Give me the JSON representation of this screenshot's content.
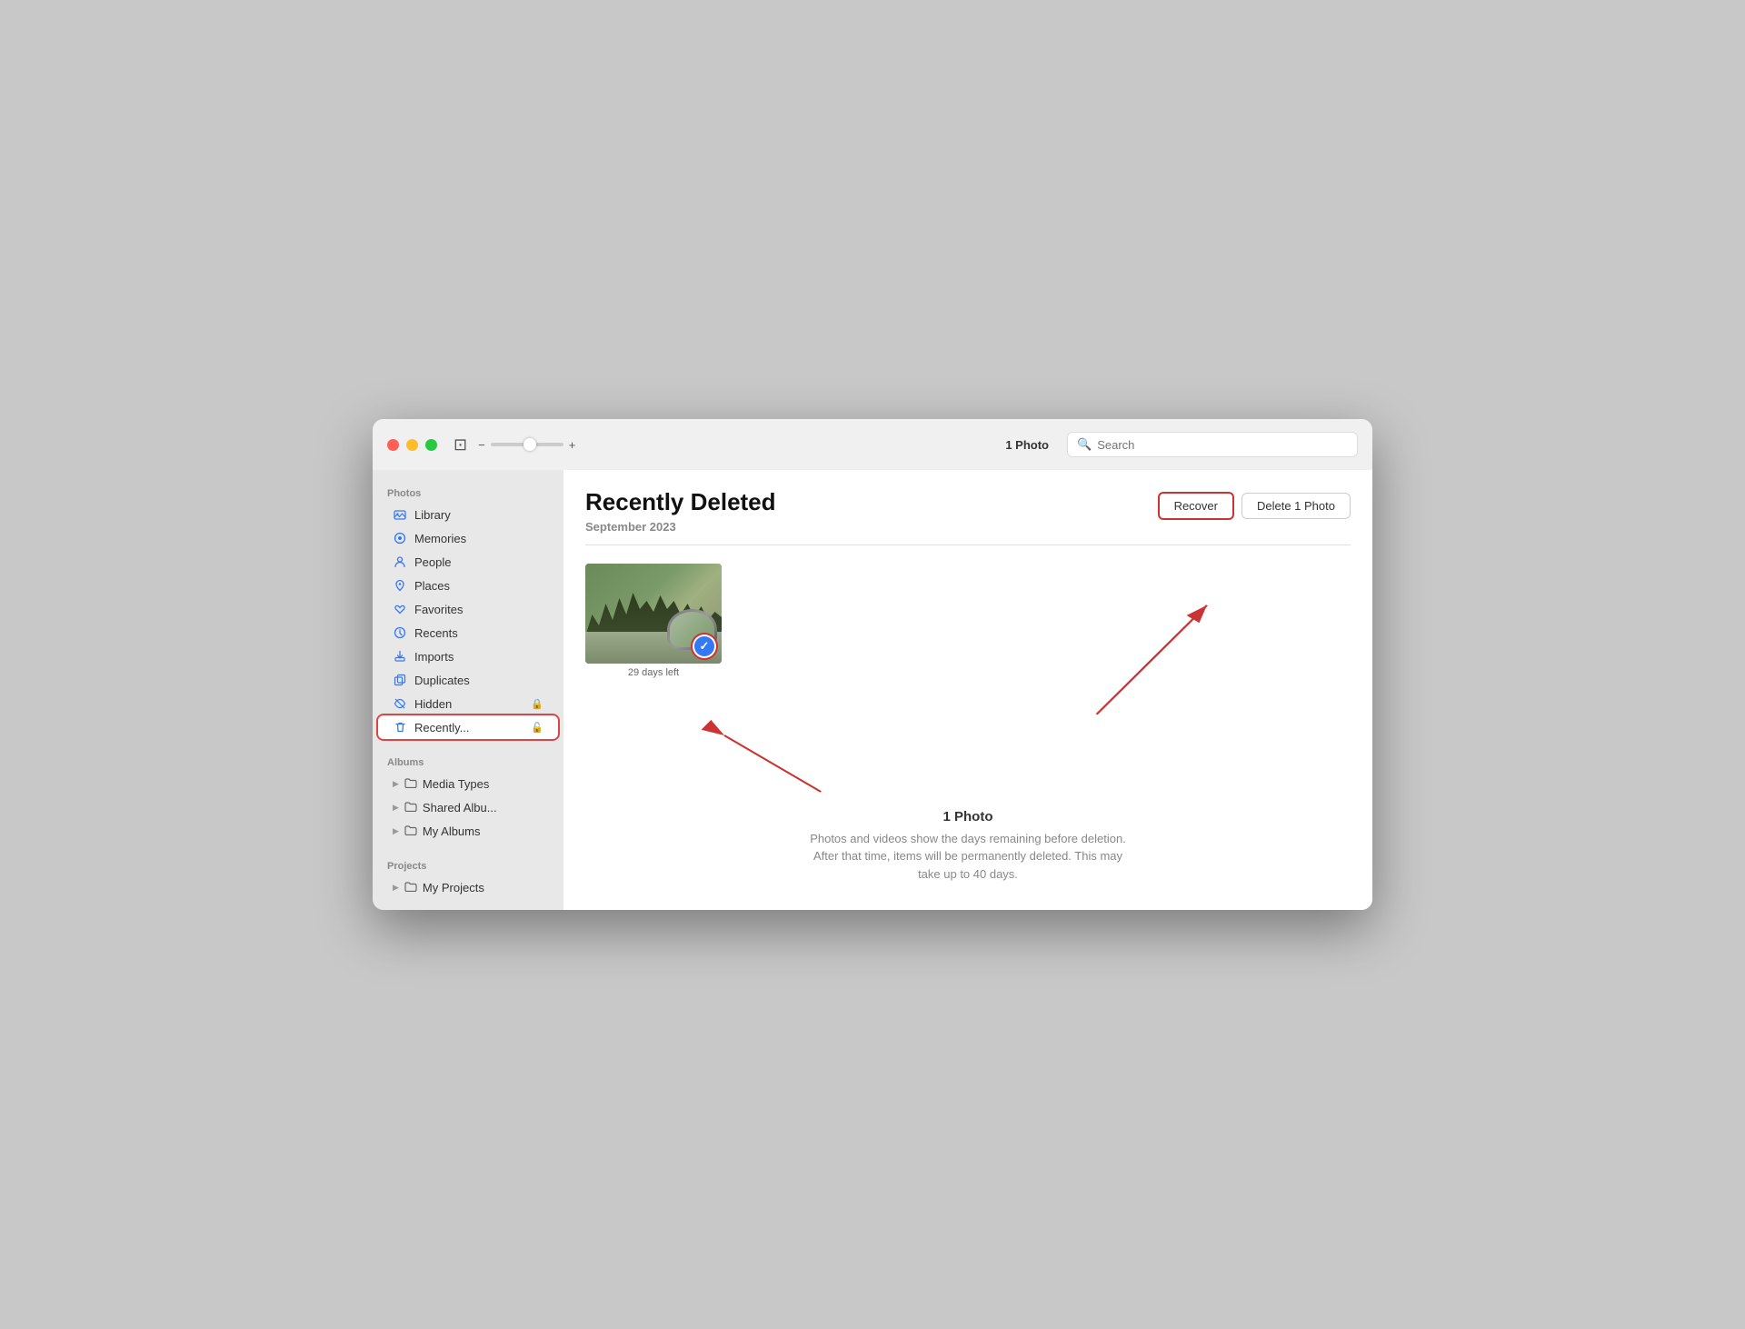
{
  "window": {
    "title": "Recently Deleted"
  },
  "toolbar": {
    "photo_count": "1 Photo",
    "search_placeholder": "Search",
    "zoom_minus": "−",
    "zoom_plus": "+"
  },
  "sidebar": {
    "photos_section_label": "Photos",
    "albums_section_label": "Albums",
    "projects_section_label": "Projects",
    "items": [
      {
        "id": "library",
        "label": "Library",
        "icon": "📷"
      },
      {
        "id": "memories",
        "label": "Memories",
        "icon": "⊙"
      },
      {
        "id": "people",
        "label": "People",
        "icon": "👤"
      },
      {
        "id": "places",
        "label": "Places",
        "icon": "📍"
      },
      {
        "id": "favorites",
        "label": "Favorites",
        "icon": "♡"
      },
      {
        "id": "recents",
        "label": "Recents",
        "icon": "🕐"
      },
      {
        "id": "imports",
        "label": "Imports",
        "icon": "⬇"
      },
      {
        "id": "duplicates",
        "label": "Duplicates",
        "icon": "⧉"
      },
      {
        "id": "hidden",
        "label": "Hidden",
        "icon": "🙈",
        "lock": true
      },
      {
        "id": "recently-deleted",
        "label": "Recently...",
        "icon": "🗑",
        "active": true,
        "lock": true
      }
    ],
    "album_items": [
      {
        "id": "media-types",
        "label": "Media Types"
      },
      {
        "id": "shared-albums",
        "label": "Shared Albu..."
      },
      {
        "id": "my-albums",
        "label": "My Albums"
      }
    ],
    "project_items": [
      {
        "id": "my-projects",
        "label": "My Projects"
      }
    ]
  },
  "content": {
    "title": "Recently Deleted",
    "date_section": "September 2023",
    "recover_button": "Recover",
    "delete_button": "Delete 1 Photo",
    "photo": {
      "days_left": "29 days left"
    },
    "footer": {
      "count": "1 Photo",
      "description_line1": "Photos and videos show the days remaining before deletion.",
      "description_line2": "After that time, items will be permanently deleted. This may",
      "description_line3": "take up to 40 days."
    }
  }
}
